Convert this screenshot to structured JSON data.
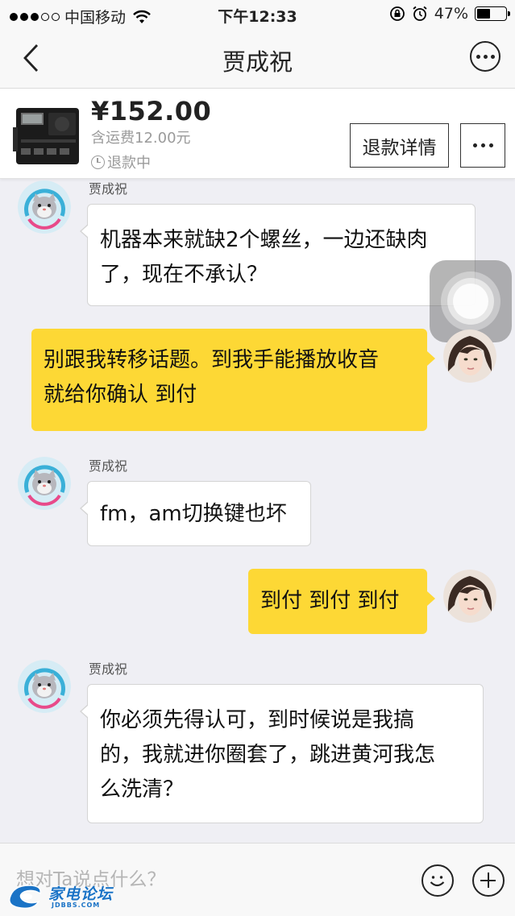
{
  "status_bar": {
    "carrier": "中国移动",
    "time": "下午12:33",
    "battery": "47%",
    "battery_level": 0.47
  },
  "nav": {
    "title": "贾成祝"
  },
  "product": {
    "price": "¥152.00",
    "shipping": "含运费12.00元",
    "status": "退款中",
    "refund_button": "退款详情"
  },
  "messages": [
    {
      "side": "in",
      "sender": "贾成祝",
      "lines": [
        "机器本来就缺2个螺丝，一边还缺肉",
        "了，现在不承认？"
      ]
    },
    {
      "side": "out",
      "lines": [
        "别跟我转移话题。到我手能播放收音",
        "就给你确认 到付"
      ]
    },
    {
      "side": "in",
      "sender": "贾成祝",
      "lines": [
        "fm，am切换键也坏"
      ]
    },
    {
      "side": "out",
      "lines": [
        "到付 到付 到付"
      ]
    },
    {
      "side": "in",
      "sender": "贾成祝",
      "lines": [
        "你必须先得认可，到时候说是我搞",
        "的，我就进你圈套了，跳进黄河我怎",
        "么洗清？"
      ]
    }
  ],
  "input": {
    "placeholder": "想对Ta说点什么？"
  },
  "watermark": {
    "text": "家电论坛",
    "sub": "JDBBS.COM"
  }
}
